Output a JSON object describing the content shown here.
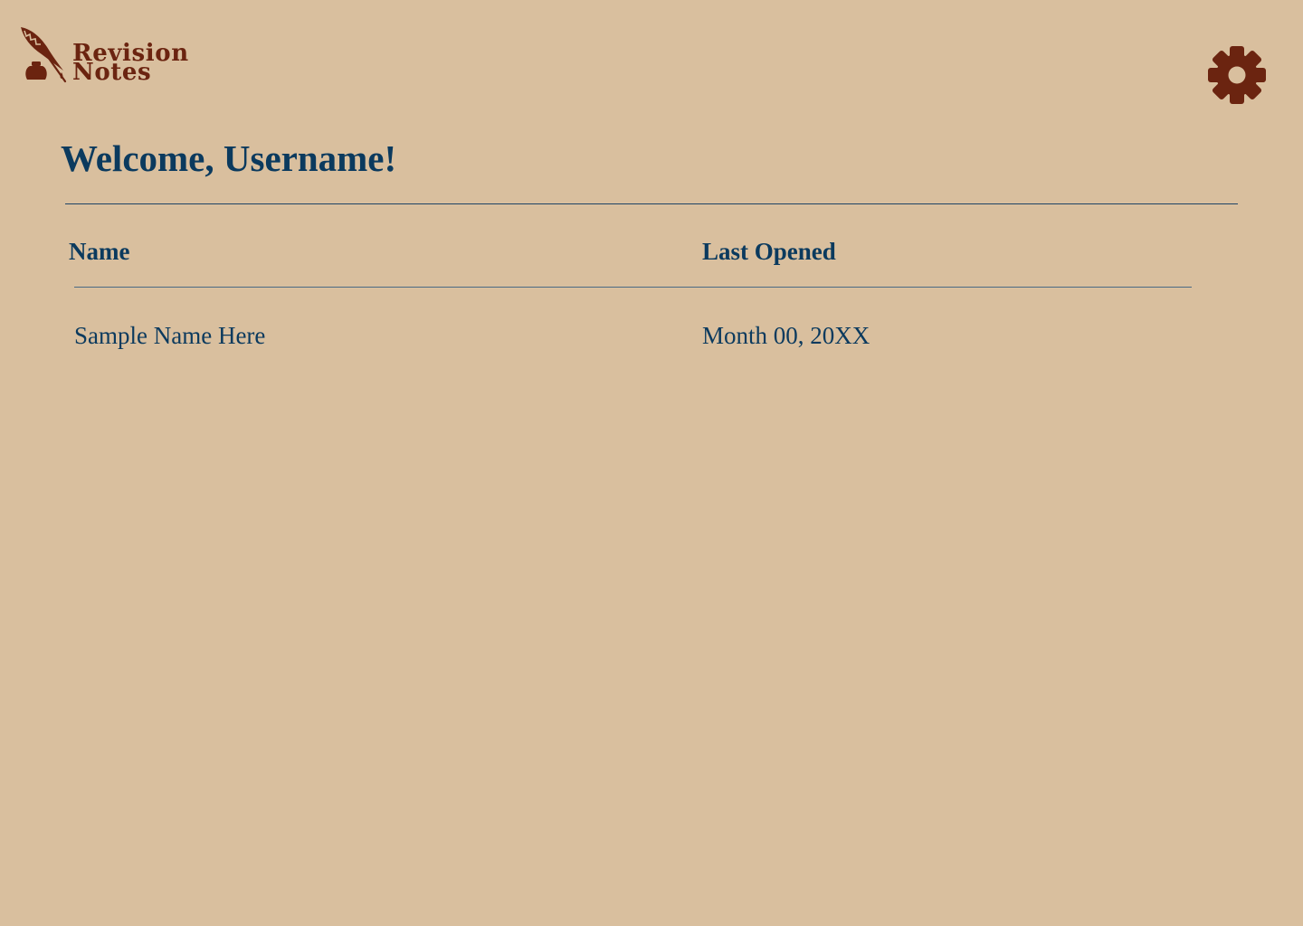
{
  "app": {
    "logo_line1": "Revision",
    "logo_line2": "Notes",
    "logo_icon": "quill-inkwell-icon",
    "settings_icon": "gear-icon"
  },
  "colors": {
    "background": "#d9bf9e",
    "brand": "#6b2410",
    "text": "#0b3a5e"
  },
  "header": {
    "welcome": "Welcome, Username!"
  },
  "table": {
    "columns": [
      "Name",
      "Last Opened"
    ],
    "rows": [
      {
        "name": "Sample Name Here",
        "last_opened": "Month 00, 20XX"
      }
    ]
  }
}
